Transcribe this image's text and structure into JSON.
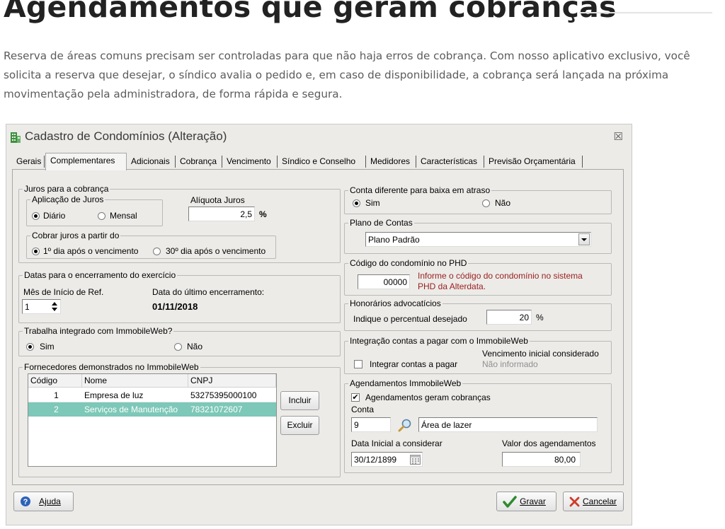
{
  "article": {
    "title": "Agendamentos que geram cobranças",
    "body": "Reserva de áreas comuns precisam ser controladas para que não haja erros de cobrança. Com nosso aplicativo exclusivo, você solicita a reserva que desejar, o síndico avalia o pedido e, em caso de disponibilidade, a cobrança será lançada na próxima movimentação pela administradora, de forma rápida e segura."
  },
  "window": {
    "title": "Cadastro de Condomínios (Alteração)",
    "close_glyph": "☒",
    "icon": "building-icon"
  },
  "tabs": [
    "Gerais",
    "Complementares",
    "Adicionais",
    "Cobrança",
    "Vencimento",
    "Síndico e Conselho",
    "Medidores",
    "Características",
    "Previsão Orçamentária"
  ],
  "active_tab": "Complementares",
  "juros": {
    "group_title": "Juros para a cobrança",
    "aplicacao_title": "Aplicação de Juros",
    "opt_diario": "Diário",
    "opt_mensal": "Mensal",
    "aliquota_label": "Alíquota Juros",
    "aliquota_value": "2,5",
    "percent": "%",
    "cobrar_title": "Cobrar juros a partir do",
    "opt_primeiro": "1º dia após o vencimento",
    "opt_trigesimo": "30º dia após o vencimento"
  },
  "datas": {
    "group_title": "Datas para o encerramento do exercício",
    "mes_label": "Mês de Início de Ref.",
    "mes_value": "1",
    "ultimo_label": "Data do último encerramento:",
    "ultimo_value": "01/11/2018"
  },
  "immobile": {
    "group_title": "Trabalha integrado com ImmobileWeb?",
    "opt_sim": "Sim",
    "opt_nao": "Não"
  },
  "fornecedores": {
    "group_title": "Fornecedores demonstrados no ImmobileWeb",
    "columns": [
      "Código",
      "Nome",
      "CNPJ"
    ],
    "rows": [
      [
        "1",
        "Empresa de luz",
        "53275395000100"
      ],
      [
        "2",
        "Serviços de Manutenção",
        "78321072607"
      ]
    ],
    "incluir": "Incluir",
    "excluir": "Excluir"
  },
  "conta_diferente": {
    "group_title": "Conta diferente para baixa em atraso",
    "opt_sim": "Sim",
    "opt_nao": "Não"
  },
  "plano": {
    "group_title": "Plano de Contas",
    "value": "Plano Padrão"
  },
  "codigo_phd": {
    "group_title": "Código do condomínio no PHD",
    "value": "00000",
    "warning_line1": "Informe o código do condomínio no sistema",
    "warning_line2": "PHD da Alterdata."
  },
  "honorarios": {
    "group_title": "Honorários advocatícios",
    "label": "Indique o percentual desejado",
    "value": "20",
    "percent": "%"
  },
  "integracao": {
    "group_title": "Integração contas a pagar com o ImmobileWeb",
    "checkbox_label": "Integrar contas a pagar",
    "venc_label": "Vencimento inicial considerado",
    "venc_value": "Não informado"
  },
  "agendamentos": {
    "group_title": "Agendamentos ImmobileWeb",
    "checkbox_label": "Agendamentos geram cobranças",
    "checkbox_checked": true,
    "conta_label": "Conta",
    "conta_code": "9",
    "conta_name": "Área de lazer",
    "data_label": "Data Inicial a considerar",
    "data_value": "30/12/1899",
    "valor_label": "Valor dos agendamentos",
    "valor_value": "80,00"
  },
  "footer": {
    "ajuda": "Ajuda",
    "gravar": "Gravar",
    "cancelar": "Cancelar"
  },
  "colors": {
    "selected_row": "#7dc8b8",
    "warning_text": "#9a1e1e",
    "gravar_check": "#2f8a2f",
    "cancel_x": "#d03a2a"
  }
}
